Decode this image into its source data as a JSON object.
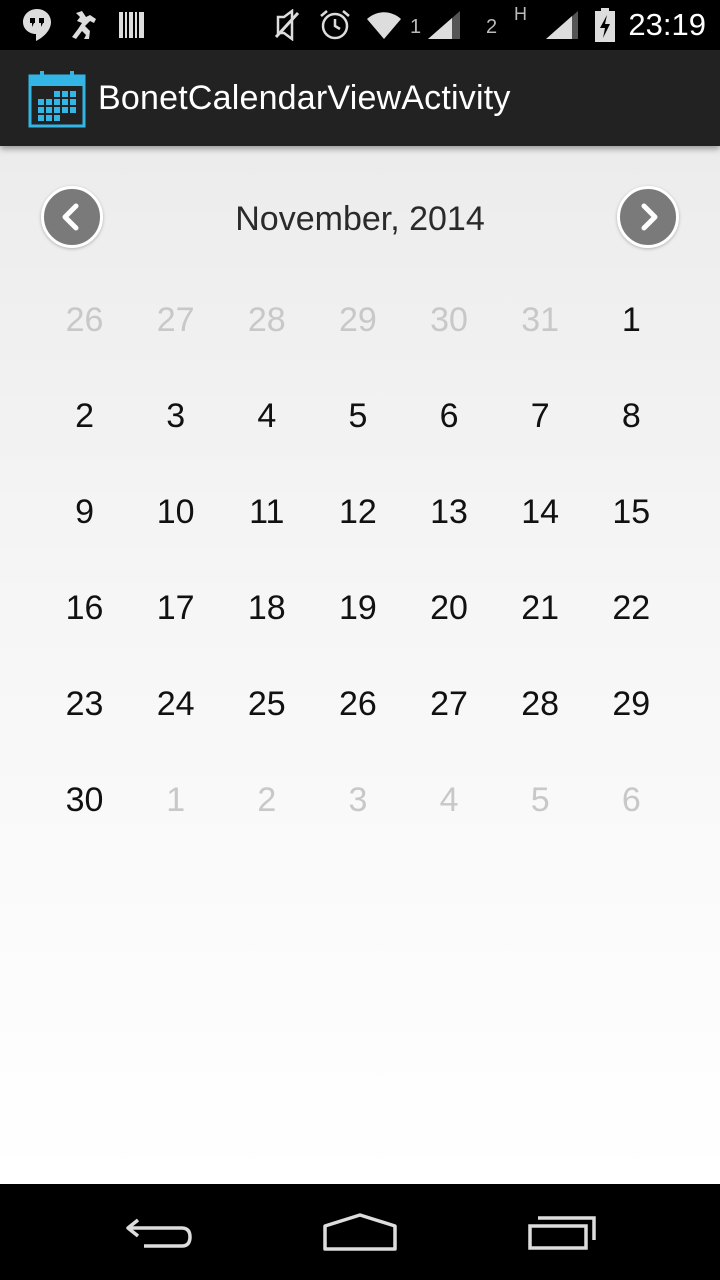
{
  "status_bar": {
    "time": "23:19",
    "sim1_label": "1",
    "sim2_label": "2",
    "network_type": "H",
    "icons": [
      "hangouts-icon",
      "android-debug-icon",
      "barcode-icon",
      "muted-icon",
      "alarm-icon",
      "wifi-icon",
      "signal-icon",
      "battery-charging-icon"
    ]
  },
  "app": {
    "title": "BonetCalendarViewActivity",
    "accent_color": "#33b5e5"
  },
  "calendar": {
    "month_label": "November, 2014",
    "weeks": [
      [
        {
          "d": "26",
          "cur": false
        },
        {
          "d": "27",
          "cur": false
        },
        {
          "d": "28",
          "cur": false
        },
        {
          "d": "29",
          "cur": false
        },
        {
          "d": "30",
          "cur": false
        },
        {
          "d": "31",
          "cur": false
        },
        {
          "d": "1",
          "cur": true
        }
      ],
      [
        {
          "d": "2",
          "cur": true
        },
        {
          "d": "3",
          "cur": true
        },
        {
          "d": "4",
          "cur": true
        },
        {
          "d": "5",
          "cur": true
        },
        {
          "d": "6",
          "cur": true
        },
        {
          "d": "7",
          "cur": true
        },
        {
          "d": "8",
          "cur": true
        }
      ],
      [
        {
          "d": "9",
          "cur": true
        },
        {
          "d": "10",
          "cur": true
        },
        {
          "d": "11",
          "cur": true
        },
        {
          "d": "12",
          "cur": true
        },
        {
          "d": "13",
          "cur": true
        },
        {
          "d": "14",
          "cur": true
        },
        {
          "d": "15",
          "cur": true
        }
      ],
      [
        {
          "d": "16",
          "cur": true
        },
        {
          "d": "17",
          "cur": true
        },
        {
          "d": "18",
          "cur": true
        },
        {
          "d": "19",
          "cur": true
        },
        {
          "d": "20",
          "cur": true
        },
        {
          "d": "21",
          "cur": true
        },
        {
          "d": "22",
          "cur": true
        }
      ],
      [
        {
          "d": "23",
          "cur": true
        },
        {
          "d": "24",
          "cur": true
        },
        {
          "d": "25",
          "cur": true
        },
        {
          "d": "26",
          "cur": true
        },
        {
          "d": "27",
          "cur": true
        },
        {
          "d": "28",
          "cur": true
        },
        {
          "d": "29",
          "cur": true
        }
      ],
      [
        {
          "d": "30",
          "cur": true
        },
        {
          "d": "1",
          "cur": false
        },
        {
          "d": "2",
          "cur": false
        },
        {
          "d": "3",
          "cur": false
        },
        {
          "d": "4",
          "cur": false
        },
        {
          "d": "5",
          "cur": false
        },
        {
          "d": "6",
          "cur": false
        }
      ]
    ]
  },
  "navigation": {
    "buttons": [
      "back-icon",
      "home-icon",
      "recents-icon"
    ]
  }
}
